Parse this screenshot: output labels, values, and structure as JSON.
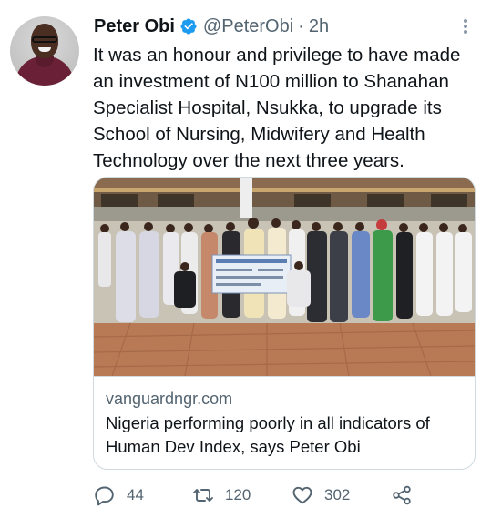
{
  "tweet": {
    "author_name": "Peter Obi",
    "handle": "@PeterObi",
    "separator": "·",
    "time": "2h",
    "text": "It was an honour and privilege to have made an investment of N100 million to Shanahan Specialist Hospital, Nsukka, to upgrade its School of Nursing, Midwifery and Health Technology over the next three years."
  },
  "card": {
    "domain": "vanguardngr.com",
    "title": "Nigeria performing poorly in all indicators of Human Dev Index, says Peter Obi"
  },
  "actions": {
    "replies": "44",
    "retweets": "120",
    "likes": "302"
  },
  "icons": {
    "verified": "verified-badge-icon",
    "more": "more-options-icon",
    "reply": "reply-icon",
    "retweet": "retweet-icon",
    "like": "like-icon",
    "share": "share-icon"
  },
  "colors": {
    "verified_blue": "#1d9bf0",
    "secondary_text": "#536471",
    "primary_text": "#0f1419",
    "border": "#cfd9de"
  }
}
